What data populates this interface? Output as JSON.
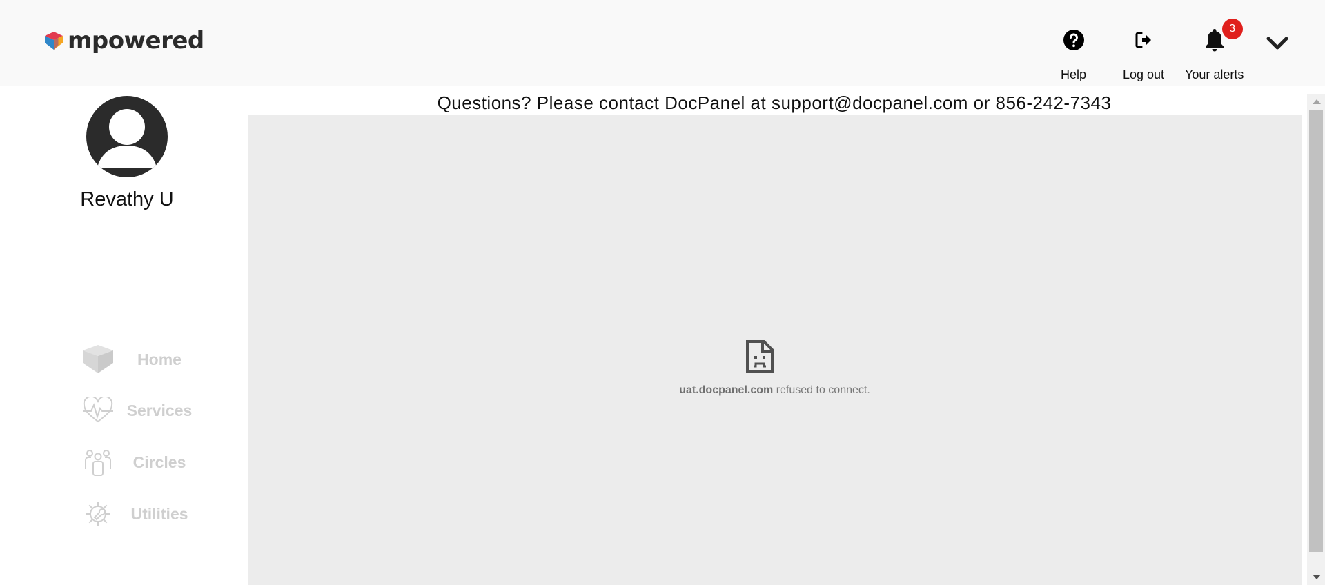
{
  "brand": {
    "name": "mpowered",
    "logo_icon": "heart-logo-icon"
  },
  "header": {
    "help": {
      "label": "Help",
      "icon": "help-circle-icon"
    },
    "logout": {
      "label": "Log out",
      "icon": "logout-icon"
    },
    "alerts": {
      "label": "Your alerts",
      "icon": "bell-icon",
      "count": "3"
    },
    "menu_icon": "chevron-down-icon"
  },
  "user": {
    "name": "Revathy U",
    "avatar_icon": "user-avatar-icon"
  },
  "sidebar": {
    "items": [
      {
        "label": "Home",
        "icon": "heart-home-icon"
      },
      {
        "label": "Services",
        "icon": "heart-pulse-icon"
      },
      {
        "label": "Circles",
        "icon": "people-group-icon"
      },
      {
        "label": "Utilities",
        "icon": "gear-wrench-icon"
      }
    ]
  },
  "main": {
    "contact_text": "Questions? Please contact DocPanel at support@docpanel.com or 856-242-7343",
    "error": {
      "host": "uat.docpanel.com",
      "message": "refused to connect.",
      "icon": "sad-document-icon"
    }
  },
  "colors": {
    "header_bg": "#f9f9f9",
    "frame_bg": "#ececec",
    "badge": "#e0201d",
    "nav_text": "#cfcfcf",
    "logo_red": "#e23b4f",
    "logo_orange": "#f5a623",
    "logo_blue": "#2f87c9"
  }
}
